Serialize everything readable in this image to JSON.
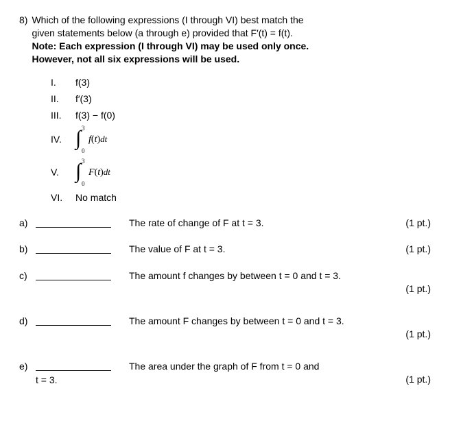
{
  "problem": {
    "number": "8)",
    "stem_line1": "Which of the following expressions (I through VI) best match the",
    "stem_line2": "given statements below (a through e) provided that  F′(t) = f(t).",
    "note_line1": "Note:  Each expression (I through VI) may be used only once.",
    "note_line2": "However, not all six expressions will be used."
  },
  "expressions": {
    "I": {
      "rn": "I.",
      "text": "f(3)"
    },
    "II": {
      "rn": "II.",
      "text": "f′(3)"
    },
    "III": {
      "rn": "III.",
      "text": "f(3) − f(0)"
    },
    "IV": {
      "rn": "IV.",
      "upper": "3",
      "lower": "0",
      "fn": "f",
      "arg": "(t)",
      "d": "dt"
    },
    "V": {
      "rn": "V.",
      "upper": "3",
      "lower": "0",
      "fn": "F",
      "arg": "(t)",
      "d": "dt"
    },
    "VI": {
      "rn": "VI.",
      "text": "No match"
    }
  },
  "questions": {
    "a": {
      "label": "a)",
      "text": "The rate of change of  F  at  t = 3.",
      "pts": "(1 pt.)"
    },
    "b": {
      "label": "b)",
      "text": "The value of  F  at  t = 3.",
      "pts": "(1 pt.)"
    },
    "c": {
      "label": "c)",
      "text": "The amount  f  changes by between  t = 0  and  t = 3.",
      "pts": "(1 pt.)"
    },
    "d": {
      "label": "d)",
      "text": "The amount  F  changes by between  t = 0  and  t = 3.",
      "pts": "(1 pt.)"
    },
    "e": {
      "label": "e)",
      "text": "The area under the graph of  F  from  t = 0  and",
      "cont": "t = 3.",
      "pts": "(1 pt.)"
    }
  }
}
